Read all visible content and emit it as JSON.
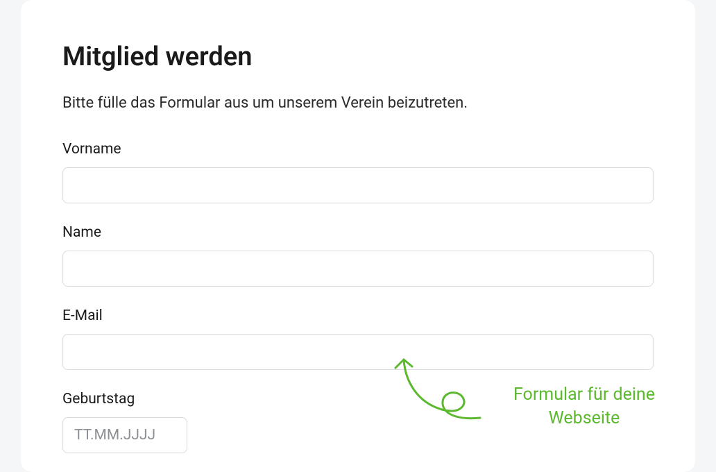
{
  "form": {
    "title": "Mitglied werden",
    "description": "Bitte fülle das Formular aus um unserem Verein beizutreten.",
    "fields": {
      "firstname": {
        "label": "Vorname",
        "value": ""
      },
      "lastname": {
        "label": "Name",
        "value": ""
      },
      "email": {
        "label": "E-Mail",
        "value": ""
      },
      "birthday": {
        "label": "Geburtstag",
        "placeholder": "TT.MM.JJJJ",
        "value": ""
      }
    }
  },
  "annotation": {
    "text": "Formular für deine Webseite",
    "color": "#5cb82e"
  }
}
